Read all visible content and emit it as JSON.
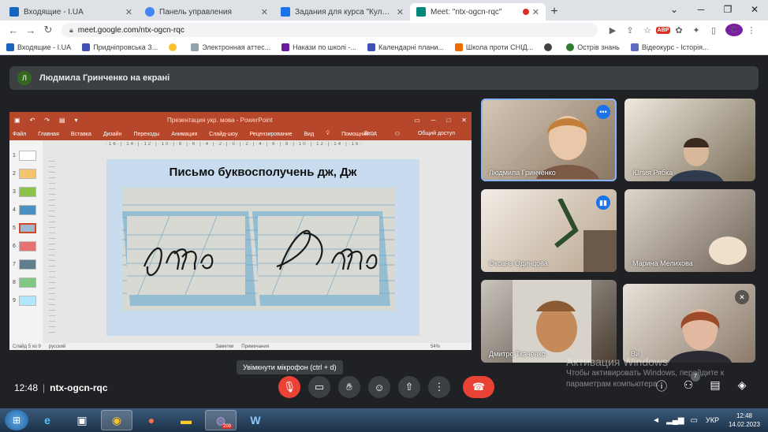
{
  "browser": {
    "tabs": [
      {
        "title": "Входящие - I.UA",
        "favicon_color": "#1565c0"
      },
      {
        "title": "Панель управления",
        "favicon_color": "#4285f4"
      },
      {
        "title": "Задания для курса \"Культура до",
        "favicon_color": "#1a73e8"
      },
      {
        "title": "Meet: \"ntx-ogcn-rqc\"",
        "favicon_color": "#00897b",
        "active": true
      }
    ],
    "url": "meet.google.com/ntx-ogcn-rqc",
    "profile_initial": "C",
    "adblock_label": "ABP",
    "bookmarks": [
      {
        "label": "Входящие - I.UA",
        "color": "#1565c0"
      },
      {
        "label": "Придніпровська З...",
        "color": "#3f51b5"
      },
      {
        "label": "",
        "color": "#fbc02d"
      },
      {
        "label": "Электронная аттес...",
        "color": "#90a4ae"
      },
      {
        "label": "Накази по школі -...",
        "color": "#6a1b9a"
      },
      {
        "label": "Календарні плани...",
        "color": "#3f51b5"
      },
      {
        "label": "Школа проти СНІД...",
        "color": "#ef6c00"
      },
      {
        "label": "",
        "color": "#424242"
      },
      {
        "label": "Острів знань",
        "color": "#2e7d32"
      },
      {
        "label": "Відеокурс - Історія...",
        "color": "#5c6bc0"
      }
    ]
  },
  "meet": {
    "presenter_initial": "Л",
    "presenter_text": "Людмила Гринченко на екрані",
    "time": "12:48",
    "meeting_code": "ntx-ogcn-rqc",
    "mic_tooltip": "Увімкнути мікрофон (ctrl + d)",
    "people_count": "7",
    "participants": [
      {
        "name": "Людмила Гринченко"
      },
      {
        "name": "Юлия Рябка"
      },
      {
        "name": "Оксана Одинцова"
      },
      {
        "name": "Марина Мелихова"
      },
      {
        "name": "Дмитро Ткаченко"
      },
      {
        "name": "Ви"
      }
    ]
  },
  "powerpoint": {
    "window_title": "Презентация укр. мова - PowerPoint",
    "menu": [
      "Файл",
      "Главная",
      "Вставка",
      "Дизайн",
      "Переходы",
      "Анимация",
      "Слайд-шоу",
      "Рецензирование",
      "Вид"
    ],
    "tell_me": "Помощник...",
    "signin": "Вход",
    "share": "Общий доступ",
    "slide_numbers": [
      "1",
      "2",
      "3",
      "4",
      "5",
      "6",
      "7",
      "8",
      "9"
    ],
    "ruler": "·16·|·14·|·12·|·10·|·8·|·6·|·4·|·2·|·0·|·2·|·4·|·6·|·8·|·10·|·12·|·14·|·16·",
    "slide_title": "Письмо буквосполучень дж, Дж",
    "status_slide": "Слайд 5 из 9",
    "status_lang": "русский",
    "status_notes": "Заметки",
    "status_comments": "Примечания",
    "status_zoom": "54%"
  },
  "windows": {
    "activation_title": "Активация Windows",
    "activation_line1": "Чтобы активировать Windows, перейдите к",
    "activation_line2": "параметрам компьютера.",
    "lang": "УКР",
    "clock_time": "12:48",
    "clock_date": "14.02.2023",
    "viber_badge": "209"
  }
}
